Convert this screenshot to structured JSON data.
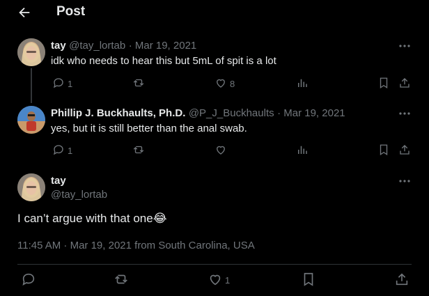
{
  "header": {
    "title": "Post"
  },
  "thread": [
    {
      "name": "tay",
      "handle": "@tay_lortab",
      "date": "· Mar 19, 2021",
      "text": "idk who needs to hear this but 5mL of spit is a lot",
      "replies": "1",
      "reposts": "",
      "likes": "8"
    },
    {
      "name": "Phillip J. Buckhaults, Ph.D.",
      "handle": "@P_J_Buckhaults",
      "date": "· Mar 19, 2021",
      "text": "yes, but it is still better than the anal swab.",
      "replies": "1",
      "reposts": "",
      "likes": ""
    }
  ],
  "main_post": {
    "name": "tay",
    "handle": "@tay_lortab",
    "text": "I can’t argue with that one",
    "emoji": "😂",
    "meta": "11:45 AM · Mar 19, 2021 from South Carolina, USA",
    "likes": "1"
  },
  "icons": {
    "back": "arrow-left-icon",
    "more": "more-dots-icon",
    "reply": "reply-bubble-icon",
    "repost": "repost-icon",
    "like": "heart-icon",
    "views": "analytics-icon",
    "bookmark": "bookmark-icon",
    "share": "share-icon"
  },
  "colors": {
    "background": "#000000",
    "text": "#e7e9ea",
    "muted": "#71767b",
    "divider": "#2f3336"
  }
}
